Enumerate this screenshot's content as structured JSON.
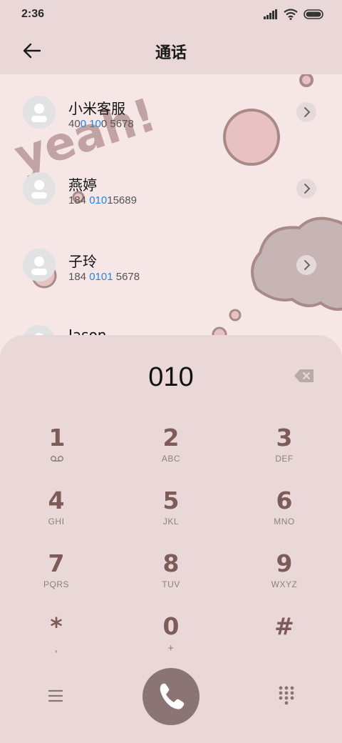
{
  "status": {
    "time": "2:36"
  },
  "header": {
    "title": "通话"
  },
  "contacts": [
    {
      "name": "小米客服",
      "num_pre": "40",
      "num_hl": "0 10",
      "num_post": "0 5678"
    },
    {
      "name": "燕婷",
      "num_pre": "184 ",
      "num_hl": "010",
      "num_post": "15689"
    },
    {
      "name": "子玲",
      "num_pre": "184 ",
      "num_hl": "0101",
      "num_post": " 5678"
    },
    {
      "name": "Jason",
      "num_pre": "",
      "num_hl": "",
      "num_post": ""
    }
  ],
  "dialpad": {
    "number": "010",
    "keys": [
      {
        "digit": "1",
        "letters": "voicemail-icon"
      },
      {
        "digit": "2",
        "letters": "ABC"
      },
      {
        "digit": "3",
        "letters": "DEF"
      },
      {
        "digit": "4",
        "letters": "GHI"
      },
      {
        "digit": "5",
        "letters": "JKL"
      },
      {
        "digit": "6",
        "letters": "MNO"
      },
      {
        "digit": "7",
        "letters": "PQRS"
      },
      {
        "digit": "8",
        "letters": "TUV"
      },
      {
        "digit": "9",
        "letters": "WXYZ"
      },
      {
        "digit": "*",
        "letters": ","
      },
      {
        "digit": "0",
        "letters": "+"
      },
      {
        "digit": "#",
        "letters": ""
      }
    ]
  },
  "decor": {
    "sticker_text": "yeah!"
  },
  "colors": {
    "accent": "#1e88e5",
    "key_digit": "#7c5b59",
    "call_button": "#8a7574",
    "panel": "#ead8d8"
  }
}
